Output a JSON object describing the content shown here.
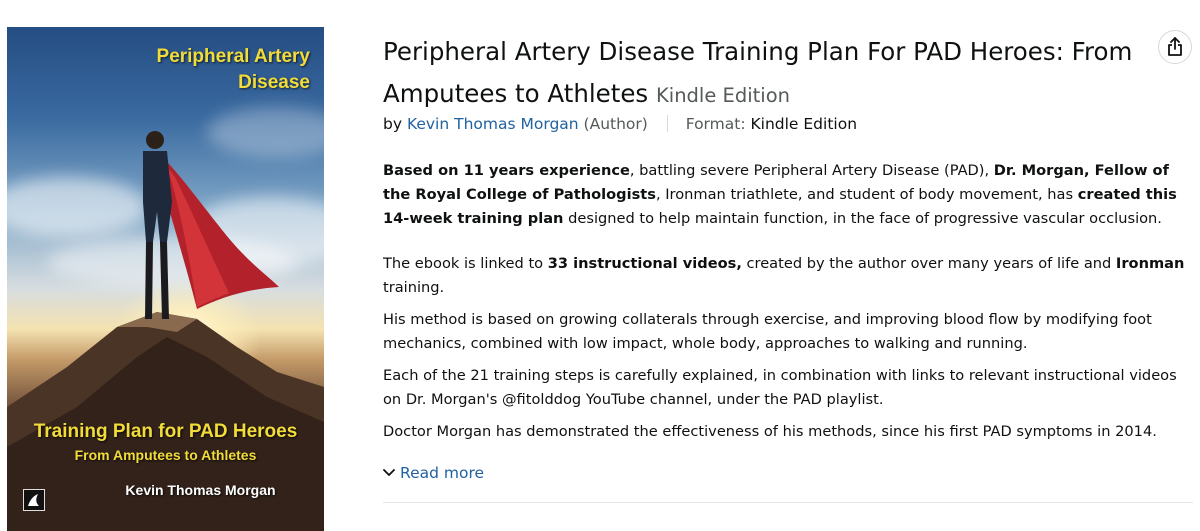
{
  "cover": {
    "title_line1": "Peripheral Artery",
    "title_line2": "Disease",
    "subtitle": "Training Plan for PAD Heroes",
    "subtitle2": "From Amputees to Athletes",
    "author": "Kevin Thomas Morgan"
  },
  "product": {
    "title": "Peripheral Artery Disease Training Plan For PAD Heroes: From Amputees to Athletes",
    "edition": "Kindle Edition",
    "by_label": "by",
    "author_name": "Kevin Thomas Morgan",
    "author_role": "(Author)",
    "format_label": "Format:",
    "format_value": "Kindle Edition"
  },
  "description": {
    "p1": {
      "b1": "Based on 11 years experience",
      "t1": ", battling severe Peripheral Artery Disease (PAD), ",
      "b2": "Dr. Morgan, Fellow of the Royal College of Pathologists",
      "t2": ", Ironman triathlete, and student of body movement, has ",
      "b3": "created this 14-week training plan",
      "t3": " designed to help maintain function, in the face of progressive vascular occlusion."
    },
    "p2": {
      "t1": "The ebook is linked to ",
      "b1": "33 instructional videos,",
      "t2": " created by the author over many years of life and ",
      "b2": "Ironman",
      "t3": " training."
    },
    "p3": "His method is based on growing collaterals through exercise, and improving blood flow by modifying foot mechanics, combined with low impact, whole body, approaches to walking and running.",
    "p4": "Each of the 21 training steps is carefully explained, in combination with links to relevant instructional videos on Dr. Morgan's @fitolddog YouTube channel, under the PAD playlist.",
    "p5": "Doctor Morgan has demonstrated the effectiveness of his methods, since his first PAD symptoms in 2014."
  },
  "read_more": "Read more",
  "icons": {
    "share": "share-icon",
    "chevron": "chevron-down-icon"
  },
  "colors": {
    "link": "#2162a1",
    "cover_text": "#f2dc3a"
  }
}
